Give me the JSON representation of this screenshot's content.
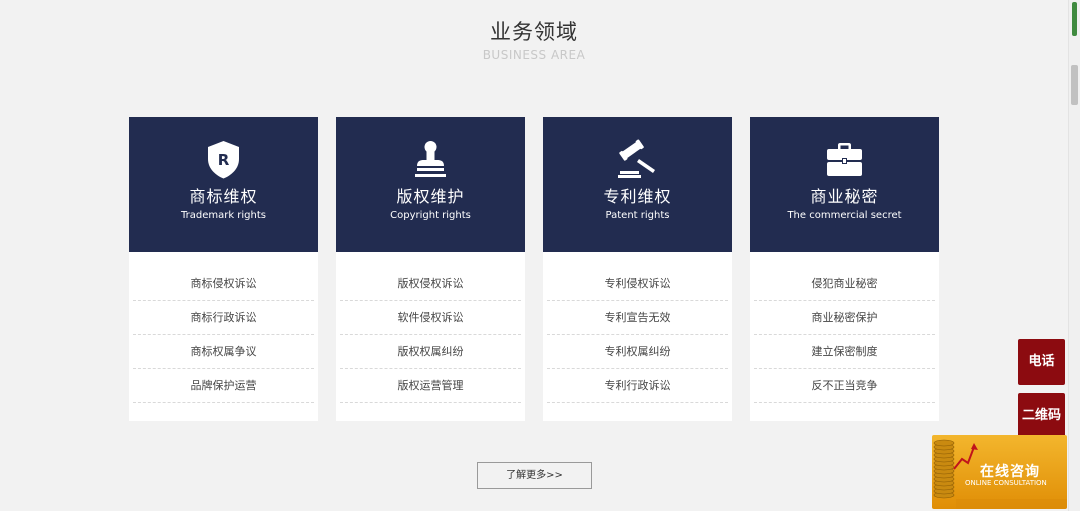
{
  "section": {
    "title_zh": "业务领域",
    "title_en": "BUSINESS AREA"
  },
  "cards": [
    {
      "title": "商标维权",
      "subtitle": "Trademark rights",
      "icon": "trademark-shield-icon",
      "icon_letter": "R",
      "items": [
        "商标侵权诉讼",
        "商标行政诉讼",
        "商标权属争议",
        "品牌保护运营"
      ]
    },
    {
      "title": "版权维护",
      "subtitle": "Copyright rights",
      "icon": "stamp-icon",
      "items": [
        "版权侵权诉讼",
        "软件侵权诉讼",
        "版权权属纠纷",
        "版权运营管理"
      ]
    },
    {
      "title": "专利维权",
      "subtitle": "Patent rights",
      "icon": "gavel-icon",
      "items": [
        "专利侵权诉讼",
        "专利宣告无效",
        "专利权属纠纷",
        "专利行政诉讼"
      ]
    },
    {
      "title": "商业秘密",
      "subtitle": "The commercial secret",
      "icon": "briefcase-icon",
      "items": [
        "侵犯商业秘密",
        "商业秘密保护",
        "建立保密制度",
        "反不正当竞争"
      ]
    }
  ],
  "more_button": "了解更多>>",
  "side": {
    "phone": "电话",
    "qr": "二维码",
    "consult_zh": "在线咨询",
    "consult_en": "ONLINE CONSULTATION"
  },
  "colors": {
    "card_header": "#222c50",
    "side_button": "#8c0b10",
    "consult_gold": "#f0a81c",
    "page_bg": "#f2f2f2"
  }
}
